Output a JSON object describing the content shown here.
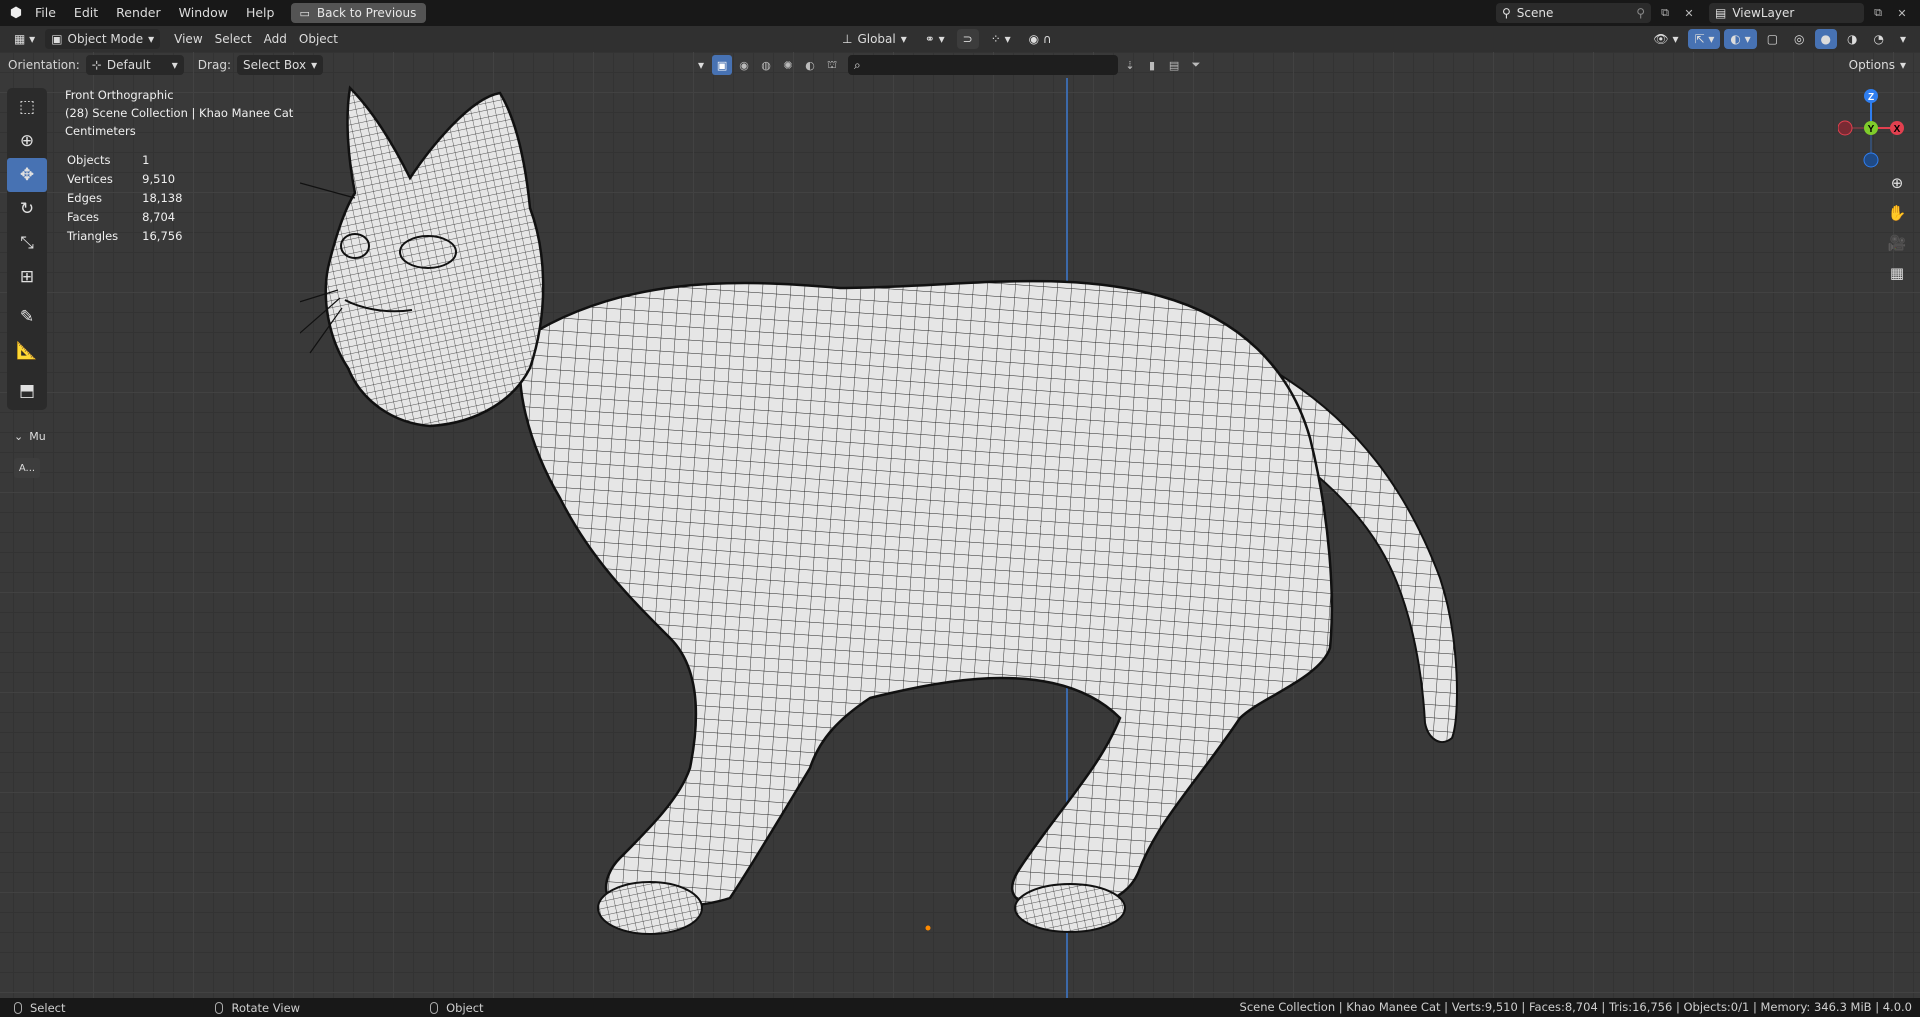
{
  "topbar": {
    "menus": [
      "File",
      "Edit",
      "Render",
      "Window",
      "Help"
    ],
    "back_button": "Back to Previous",
    "scene": "Scene",
    "view_layer": "ViewLayer"
  },
  "header": {
    "mode": "Object Mode",
    "menus": [
      "View",
      "Select",
      "Add",
      "Object"
    ],
    "transform": "Global"
  },
  "tool_header": {
    "orientation_label": "Orientation:",
    "orientation_value": "Default",
    "drag_label": "Drag:",
    "drag_value": "Select Box",
    "options": "Options"
  },
  "viewport": {
    "view_name": "Front Orthographic",
    "collection": "(28) Scene Collection | Khao Manee Cat",
    "units": "Centimeters",
    "stats": [
      {
        "label": "Objects",
        "value": "1"
      },
      {
        "label": "Vertices",
        "value": "9,510"
      },
      {
        "label": "Edges",
        "value": "18,138"
      },
      {
        "label": "Faces",
        "value": "8,704"
      },
      {
        "label": "Triangles",
        "value": "16,756"
      }
    ],
    "panel_collapse": "Mu",
    "panel_button": "A...",
    "gizmo": {
      "z": "Z",
      "y": "Y",
      "x": "X"
    }
  },
  "colors": {
    "accent": "#4772b3",
    "x_axis": "#e2404f",
    "y_axis": "#7fcc2b",
    "z_axis": "#2f7ef0",
    "viewport_bg": "#393939"
  },
  "statusbar": {
    "left": [
      "Select",
      "Rotate View",
      "Object"
    ],
    "right": "Scene Collection | Khao Manee Cat | Verts:9,510 | Faces:8,704 | Tris:16,756 | Objects:0/1 | Memory: 346.3 MiB | 4.0.0"
  }
}
